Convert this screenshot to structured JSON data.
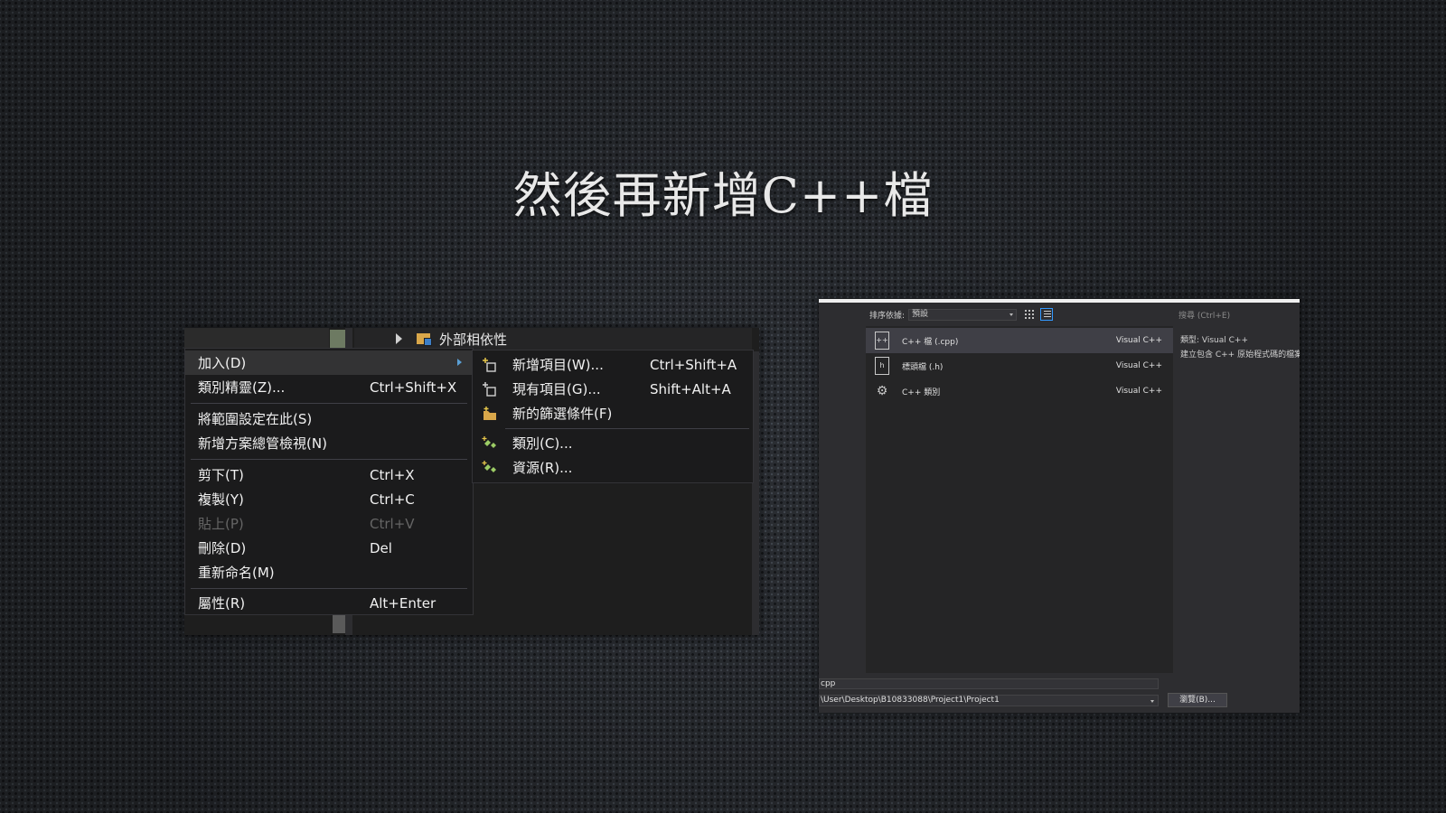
{
  "slide": {
    "title": "然後再新增C++檔"
  },
  "solution_tree": {
    "external_deps": "外部相依性"
  },
  "context_menu": {
    "items": [
      {
        "label": "加入(D)",
        "shortcut": ""
      },
      {
        "label": "類別精靈(Z)...",
        "shortcut": "Ctrl+Shift+X"
      },
      {
        "label": "將範圍設定在此(S)",
        "shortcut": ""
      },
      {
        "label": "新增方案總管檢視(N)",
        "shortcut": ""
      },
      {
        "label": "剪下(T)",
        "shortcut": "Ctrl+X"
      },
      {
        "label": "複製(Y)",
        "shortcut": "Ctrl+C"
      },
      {
        "label": "貼上(P)",
        "shortcut": "Ctrl+V"
      },
      {
        "label": "刪除(D)",
        "shortcut": "Del"
      },
      {
        "label": "重新命名(M)",
        "shortcut": ""
      },
      {
        "label": "屬性(R)",
        "shortcut": "Alt+Enter"
      }
    ]
  },
  "add_submenu": {
    "items": [
      {
        "label": "新增項目(W)...",
        "shortcut": "Ctrl+Shift+A",
        "icon": "new-item-icon"
      },
      {
        "label": "現有項目(G)...",
        "shortcut": "Shift+Alt+A",
        "icon": "existing-item-icon"
      },
      {
        "label": "新的篩選條件(F)",
        "shortcut": "",
        "icon": "new-filter-icon"
      },
      {
        "label": "類別(C)...",
        "shortcut": "",
        "icon": "class-icon"
      },
      {
        "label": "資源(R)...",
        "shortcut": "",
        "icon": "resource-icon"
      }
    ]
  },
  "dialog": {
    "sort_label": "排序依據:",
    "sort_value": "預設",
    "search_placeholder": "搜尋 (Ctrl+E)",
    "templates": [
      {
        "name": "C++ 檔 (.cpp)",
        "type": "Visual C++",
        "icon_text": "++"
      },
      {
        "name": "標頭檔 (.h)",
        "type": "Visual C++",
        "icon_text": "h"
      },
      {
        "name": "C++ 類別",
        "type": "Visual C++",
        "icon_text": "⚙"
      }
    ],
    "details_type": "類型:  Visual C++",
    "details_desc": "建立包含 C++ 原始程式碼的檔案",
    "name_value": "cpp",
    "location_value": "\\User\\Desktop\\B10833088\\Project1\\Project1",
    "browse_label": "瀏覽(B)..."
  },
  "colors": {
    "accent_blue": "#0e70c0",
    "menu_bg": "#1b1b1c",
    "disabled_text": "#656565"
  }
}
